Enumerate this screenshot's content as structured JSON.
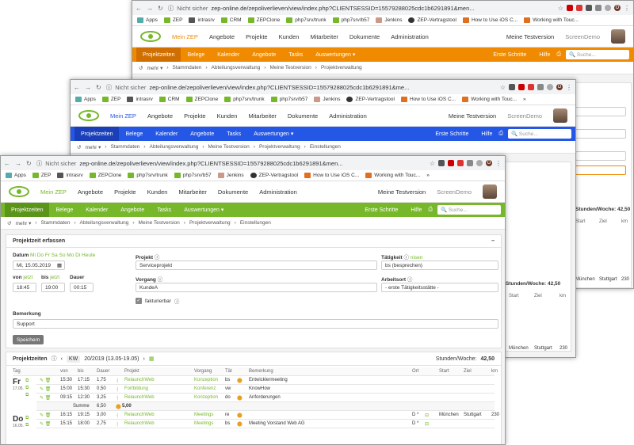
{
  "browser": {
    "not_secure": "Nicht sicher",
    "url1": "zep-online.de/zepoliverlieven/view/index.php?CLIENTSESSID=15579288025cdc1b6291891&men...",
    "url2": "zep-online.de/zepoliverlieven/view/index.php?CLIENTSESSID=15579288025cdc1b6291891&me...",
    "url3": "zep-online.de/zepoliverlieven/view/index.php?CLIENTSESSID=15579288025cdc1b6291891&men...",
    "profile": "O",
    "bookmarks": [
      "Apps",
      "ZEP",
      "intrasrv",
      "CRM",
      "ZEPClone",
      "php7srv/trunk",
      "php7srv/b57",
      "Jenkins",
      "ZEP-Vertragstool",
      "How to Use iOS C...",
      "Working with Touc..."
    ],
    "bookmarks_more": "»"
  },
  "header": {
    "menu": [
      "Mein ZEP",
      "Angebote",
      "Projekte",
      "Kunden",
      "Mitarbeiter",
      "Dokumente",
      "Administration"
    ],
    "user": "Meine Testversion",
    "screen": "ScreenDemo"
  },
  "nav": {
    "items": [
      "Projektzeiten",
      "Belege",
      "Kalender",
      "Angebote",
      "Tasks",
      "Auswertungen ▾"
    ],
    "right": [
      "Erste Schritte",
      "Hilfe"
    ],
    "search_placeholder": "Suche..."
  },
  "crumbs": {
    "w1": [
      "mehr ▾",
      "Stammdaten",
      "Abteilungsverwaltung",
      "Meine Testversion",
      "Projektverwaltung"
    ],
    "w2": [
      "mehr ▾",
      "Stammdaten",
      "Abteilungsverwaltung",
      "Meine Testversion",
      "Projektverwaltung",
      "Einstellungen"
    ],
    "w3": [
      "mehr ▾",
      "Stammdaten",
      "Abteilungsverwaltung",
      "Meine Testversion",
      "Projektverwaltung",
      "Einstellungen"
    ]
  },
  "form": {
    "title": "Projektzeit erfassen",
    "datum_label": "Datum",
    "datum_days": "Mi Do Fr Sa So Mo Di Heute",
    "datum_value": "Mi, 15.05.2019",
    "projekt_label": "Projekt",
    "projekt_value": "Serviceprojekt",
    "taetigkeit_label": "Tätigkeit",
    "taetigkeit_link": "nisen",
    "taetigkeit_value": "bs (besprechen)",
    "von_label": "von",
    "von_link": "jetzt",
    "von_value": "18:45",
    "bis_label": "bis",
    "bis_link": "jetzt",
    "bis_value": "19:00",
    "dauer_label": "Dauer",
    "dauer_value": "00:15",
    "vorgang_label": "Vorgang",
    "vorgang_value": "KundeA",
    "arbeitsort_label": "Arbeitsort",
    "arbeitsort_value": "- erste Tätigkeitsstätte -",
    "fakt_label": "fakturierbar",
    "bemerkung_label": "Bemerkung",
    "bemerkung_value": "Support",
    "save": "Speichern"
  },
  "times": {
    "title": "Projektzeiten",
    "kw": "KW",
    "week": "20/2019 (13.05-19.05)",
    "week_hours_label": "Stunden/Woche:",
    "week_hours": "42,50",
    "cols": [
      "Tag",
      "von",
      "bis",
      "Dauer",
      "Projekt",
      "Vorgang",
      "Tät",
      "Bemerkung",
      "Ort",
      "Start",
      "Ziel",
      "km"
    ],
    "day1": {
      "name": "Fr",
      "date": "17.05."
    },
    "day2": {
      "name": "Do",
      "date": "16.05."
    },
    "rows": [
      {
        "von": "15:30",
        "bis": "17:15",
        "dauer": "1,75",
        "projekt": "RelaunchWeb",
        "vorgang": "Konzeption",
        "taet": "bs",
        "bem": "Entwicklermeeting",
        "ort": "",
        "start": "",
        "ziel": "",
        "km": ""
      },
      {
        "von": "15:00",
        "bis": "15:30",
        "dauer": "0,50",
        "projekt": "Fortbildung",
        "vorgang": "Konferenz",
        "taet": "vw",
        "bem": "KnowHow",
        "ort": "",
        "start": "",
        "ziel": "",
        "km": ""
      },
      {
        "von": "09:15",
        "bis": "12:30",
        "dauer": "3,25",
        "projekt": "RelaunchWeb",
        "vorgang": "Konzeption",
        "taet": "do",
        "bem": "Anforderungen",
        "ort": "",
        "start": "",
        "ziel": "",
        "km": ""
      },
      {
        "von": "16:15",
        "bis": "19:15",
        "dauer": "3,00",
        "projekt": "RelaunchWeb",
        "vorgang": "Meetings",
        "taet": "re",
        "bem": "",
        "ort": "D *",
        "start": "München",
        "ziel": "Stuttgart",
        "km": "230"
      },
      {
        "von": "15:15",
        "bis": "18:00",
        "dauer": "2,75",
        "projekt": "RelaunchWeb",
        "vorgang": "Meetings",
        "taet": "bs",
        "bem": "Meeting Vorstand Web AG",
        "ort": "D *",
        "start": "",
        "ziel": "",
        "km": ""
      }
    ],
    "summe_label": "Summe",
    "summe_value": "6,50",
    "summe_extra": "5,00"
  },
  "bg": {
    "w1_hours_label": "Stunden/Woche:",
    "w1_hours": "42,50",
    "w1_cols": [
      "Start",
      "Ziel",
      "km"
    ],
    "w1_row": [
      "München",
      "Stuttgart",
      "230"
    ],
    "w2_hours_label": "Stunden/Woche:",
    "w2_hours": "42,50",
    "w2_cols": [
      "Start",
      "Ziel",
      "km"
    ],
    "w2_row": [
      "München",
      "Stuttgart",
      "230"
    ]
  },
  "colors": {
    "orange": "#f08a00",
    "blue": "#2457e6",
    "green": "#76b82a"
  }
}
